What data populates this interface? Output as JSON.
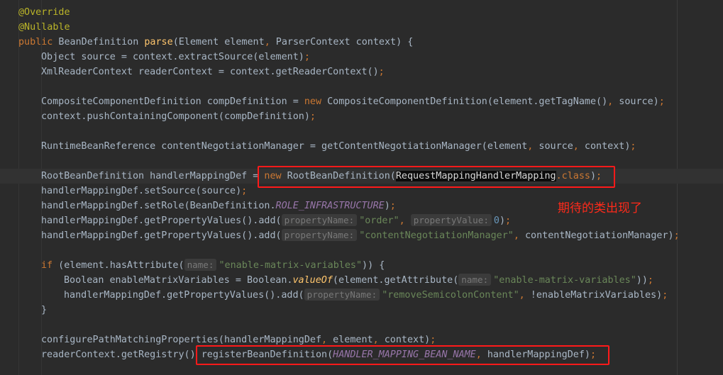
{
  "code": {
    "l1_annotation": "@Override",
    "l2_annotation": "@Nullable",
    "l3_kw": "public",
    "l3_type": " BeanDefinition ",
    "l3_fn": "parse",
    "l3_rest": "(Element element",
    "l3_rest2": " ParserContext context) {",
    "l4": "Object source = context.extractSource(element)",
    "l5": "XmlReaderContext readerContext = context.getReaderContext()",
    "l7_a": "CompositeComponentDefinition compDefinition = ",
    "l7_new": "new",
    "l7_b": " CompositeComponentDefinition(element.getTagName()",
    "l7_c": " source)",
    "l8": "context.pushContainingComponent(compDefinition)",
    "l10_a": "RuntimeBeanReference contentNegotiationManager = getContentNegotiationManager(element",
    "l10_b": " source",
    "l10_c": " context)",
    "l12_a": "RootBeanDefinition handlerMappingDef = ",
    "l12_new": "new",
    "l12_b": " RootBeanDefinition(",
    "l12_sel": "RequestMappingHandlerMapping",
    "l12_dot": ".",
    "l12_class": "class",
    "l12_c": ")",
    "l13": "handlerMappingDef.setSource(source)",
    "l14_a": "handlerMappingDef.setRole(BeanDefinition.",
    "l14_const": "ROLE_INFRASTRUCTURE",
    "l14_b": ")",
    "l15_a": "handlerMappingDef.getPropertyValues().add(",
    "l15_hint1": "propertyName:",
    "l15_str": "\"order\"",
    "l15_hint2": "propertyValue:",
    "l15_num": "0",
    "l15_b": ")",
    "l16_a": "handlerMappingDef.getPropertyValues().add(",
    "l16_hint": "propertyName:",
    "l16_str": "\"contentNegotiationManager\"",
    "l16_b": " contentNegotiationManager)",
    "l18_kw": "if",
    "l18_a": " (element.hasAttribute(",
    "l18_hint": "name:",
    "l18_str": "\"enable-matrix-variables\"",
    "l18_b": ")) {",
    "l19_a": "Boolean enableMatrixVariables = Boolean.",
    "l19_fn": "valueOf",
    "l19_b": "(element.getAttribute(",
    "l19_hint": "name:",
    "l19_str": "\"enable-matrix-variables\"",
    "l19_c": "))",
    "l20_a": "handlerMappingDef.getPropertyValues().add(",
    "l20_hint": "propertyName:",
    "l20_str": "\"removeSemicolonContent\"",
    "l20_b": " !enableMatrixVariables)",
    "l21": "}",
    "l23_a": "configurePathMatchingProperties(handlerMappingDef",
    "l23_b": " element",
    "l23_c": " context)",
    "l24_a": "readerContext.getRegistry()",
    "l24_b": " registerBeanDefinition(",
    "l24_const": "HANDLER_MAPPING_BEAN_NAME",
    "l24_c": " handlerMappingDef)"
  },
  "annotation_note": "期待的类出现了",
  "colors": {
    "background": "#2b2b2b",
    "keyword": "#cc7832",
    "string": "#6a8759",
    "highlight_box": "#ff1a1a"
  }
}
